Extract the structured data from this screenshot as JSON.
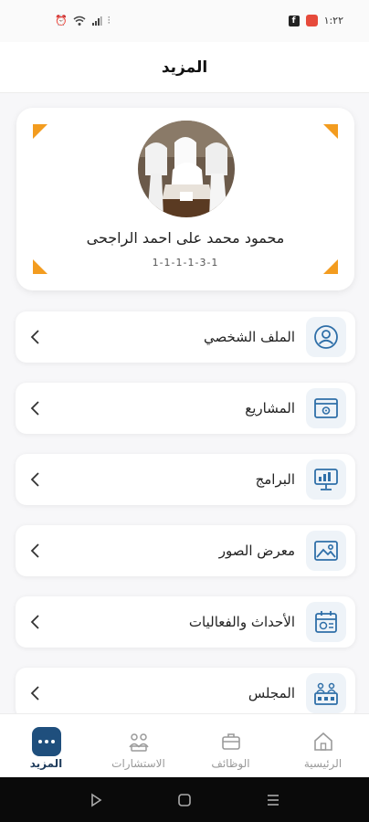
{
  "status_bar": {
    "time": "١:٢٢",
    "fb": "f"
  },
  "header": {
    "title": "المزيد"
  },
  "profile": {
    "name": "محمود محمد على احمد الراجحى",
    "id": "1-1-1-1-3-1"
  },
  "menu": {
    "items": [
      {
        "label": "الملف الشخصي",
        "icon": "user-icon"
      },
      {
        "label": "المشاريع",
        "icon": "projects-icon"
      },
      {
        "label": "البرامج",
        "icon": "programs-icon"
      },
      {
        "label": "معرض الصور",
        "icon": "gallery-icon"
      },
      {
        "label": "الأحداث والفعاليات",
        "icon": "calendar-icon"
      },
      {
        "label": "المجلس",
        "icon": "council-icon"
      }
    ]
  },
  "bottom_nav": {
    "items": [
      {
        "label": "الرئيسية",
        "icon": "home-icon"
      },
      {
        "label": "الوظائف",
        "icon": "briefcase-icon"
      },
      {
        "label": "الاستشارات",
        "icon": "consult-icon"
      },
      {
        "label": "المزيد",
        "icon": "more-icon"
      }
    ],
    "active": "المزيد"
  },
  "colors": {
    "accent": "#1f4f7d",
    "icon_blue": "#2f6fa8",
    "corner_orange": "#f39c1f"
  }
}
